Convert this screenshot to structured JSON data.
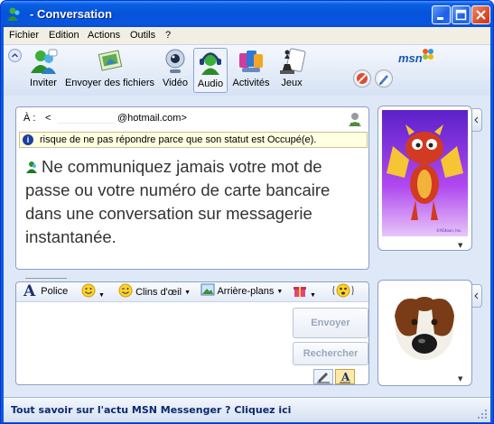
{
  "window": {
    "title": "- Conversation"
  },
  "menu": [
    "Fichier",
    "Edition",
    "Actions",
    "Outils",
    "?"
  ],
  "toolbar": {
    "items": [
      {
        "label": "Inviter",
        "icon": "invite-icon"
      },
      {
        "label": "Envoyer des fichiers",
        "icon": "send-files-icon"
      },
      {
        "label": "Vidéo",
        "icon": "webcam-icon"
      },
      {
        "label": "Audio",
        "icon": "audio-headset-icon"
      },
      {
        "label": "Activités",
        "icon": "activities-icon"
      },
      {
        "label": "Jeux",
        "icon": "games-icon"
      }
    ],
    "active": "Audio",
    "brand": "msn"
  },
  "conversation": {
    "to_label": "À :",
    "to_open": "<",
    "to_email": "@hotmail.com>",
    "notice": "risque de ne pas répondre parce que son statut est Occupé(e).",
    "warning": "Ne communiquez jamais votre mot de passe ou votre numéro de carte bancaire dans une conversation sur messagerie instantanée."
  },
  "compose": {
    "font_label": "Police",
    "winks_label": "Clins d'œil",
    "backgrounds_label": "Arrière-plans",
    "send_label": "Envoyer",
    "search_label": "Rechercher"
  },
  "statusbar": {
    "text": "Tout savoir sur l'actu MSN Messenger ? Cliquez ici"
  },
  "colors": {
    "title_bar": "#0453d9",
    "client_bg": "#dfe8f7",
    "notice_bg": "#ffffe1",
    "close_button": "#d74f2d"
  }
}
